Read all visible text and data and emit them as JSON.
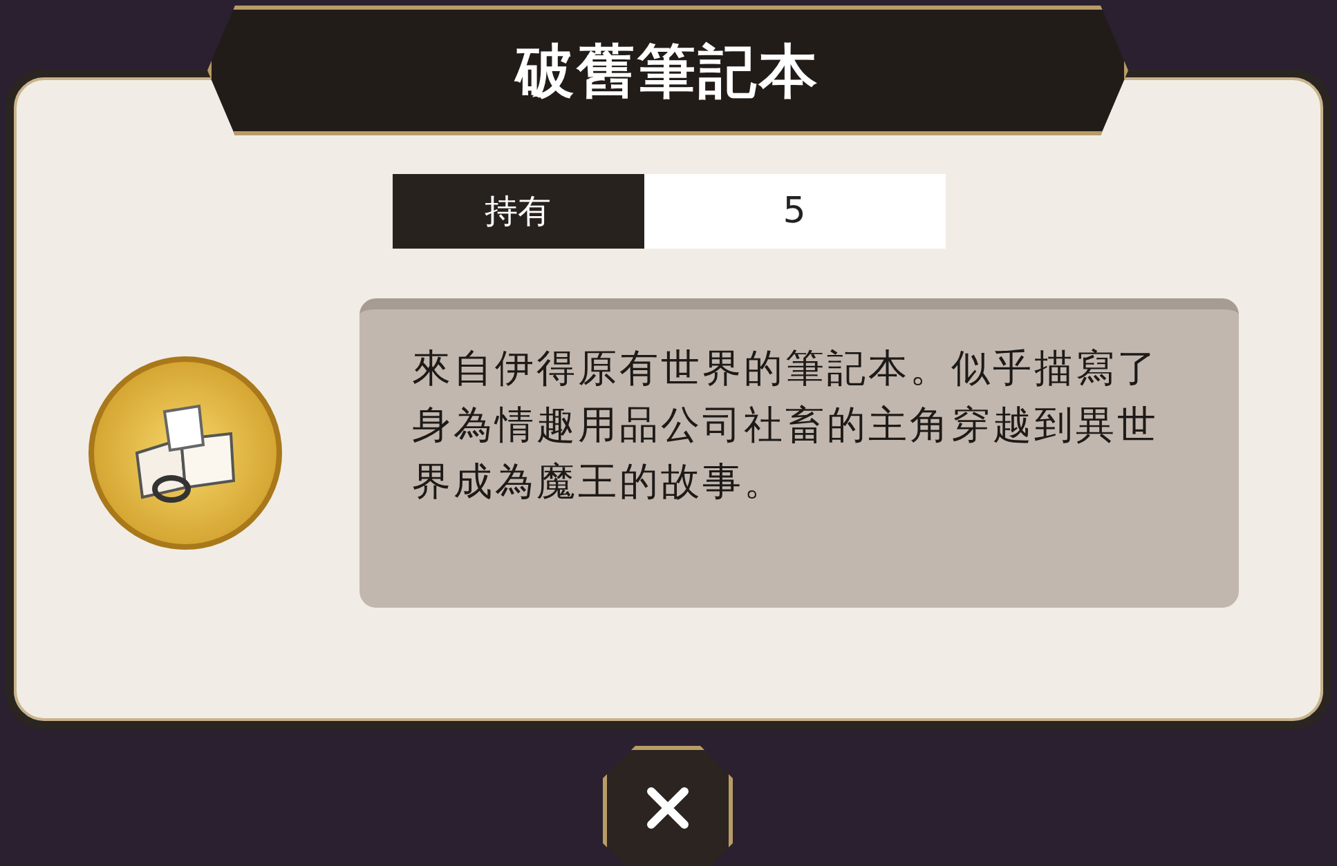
{
  "dialog": {
    "title": "破舊筆記本",
    "holding": {
      "label": "持有",
      "value": "5"
    },
    "description": "來自伊得原有世界的筆記本。似乎描寫了身為情趣用品公司社畜的主角穿越到異世界成為魔王的故事。"
  }
}
